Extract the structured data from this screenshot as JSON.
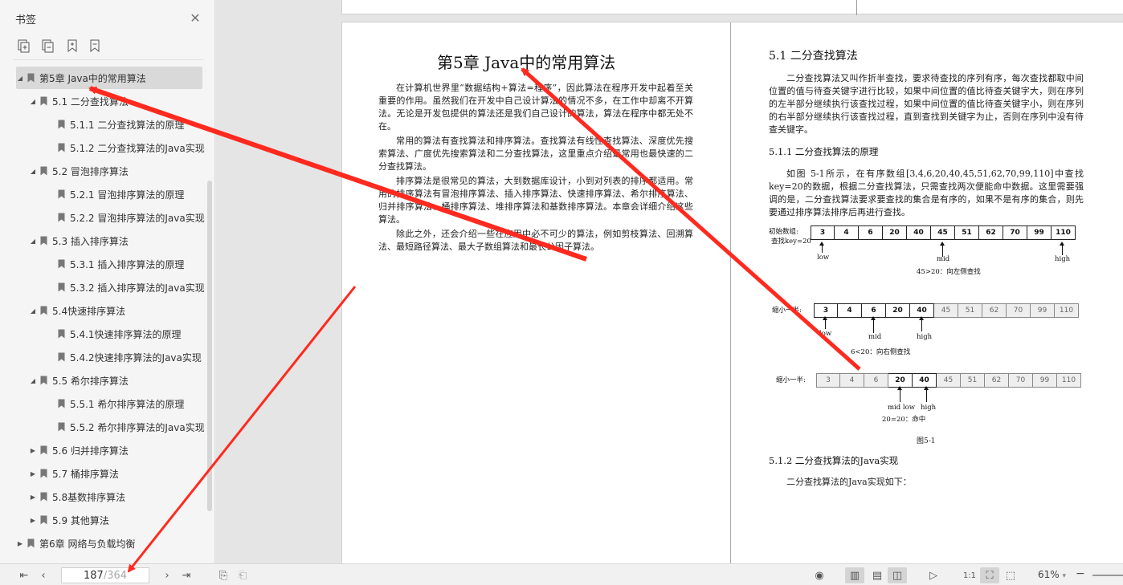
{
  "sidebar": {
    "title": "书签",
    "close_icon": "close-icon",
    "tools": [
      "expand-all-icon",
      "collapse-all-icon",
      "add-bookmark-icon",
      "bookmark-icon"
    ],
    "items": [
      {
        "label": "第5章 Java中的常用算法",
        "level": 0,
        "expanded": true,
        "selected": true
      },
      {
        "label": "5.1 二分查找算法",
        "level": 1,
        "expanded": true
      },
      {
        "label": "5.1.1 二分查找算法的原理",
        "level": 2
      },
      {
        "label": "5.1.2 二分查找算法的Java实现",
        "level": 2
      },
      {
        "label": "5.2 冒泡排序算法",
        "level": 1,
        "expanded": true
      },
      {
        "label": "5.2.1 冒泡排序算法的原理",
        "level": 2
      },
      {
        "label": "5.2.2 冒泡排序算法的Java实现",
        "level": 2
      },
      {
        "label": "5.3 插入排序算法",
        "level": 1,
        "expanded": true
      },
      {
        "label": "5.3.1 插入排序算法的原理",
        "level": 2
      },
      {
        "label": "5.3.2 插入排序算法的Java实现",
        "level": 2
      },
      {
        "label": "5.4快速排序算法",
        "level": 1,
        "expanded": true
      },
      {
        "label": "5.4.1快速排序算法的原理",
        "level": 2
      },
      {
        "label": "5.4.2快速排序算法的Java实现",
        "level": 2
      },
      {
        "label": "5.5 希尔排序算法",
        "level": 1,
        "expanded": true
      },
      {
        "label": "5.5.1 希尔排序算法的原理",
        "level": 2
      },
      {
        "label": "5.5.2 希尔排序算法的Java实现",
        "level": 2
      },
      {
        "label": "5.6 归并排序算法",
        "level": 1,
        "expanded": false
      },
      {
        "label": "5.7 桶排序算法",
        "level": 1,
        "expanded": false
      },
      {
        "label": "5.8基数排序算法",
        "level": 1,
        "expanded": false
      },
      {
        "label": "5.9 其他算法",
        "level": 1,
        "expanded": false
      },
      {
        "label": "第6章 网络与负载均衡",
        "level": 0,
        "expanded": false
      }
    ]
  },
  "document": {
    "left": {
      "chapter_title": "第5章  Java中的常用算法",
      "paragraphs": [
        "在计算机世界里“数据结构+算法=程序”，因此算法在程序开发中起着至关重要的作用。虽然我们在开发中自己设计算法的情况不多，在工作中却离不开算法。无论是开发包提供的算法还是我们自己设计的算法，算法在程序中都无处不在。",
        "常用的算法有查找算法和排序算法。查找算法有线性查找算法、深度优先搜索算法、广度优先搜索算法和二分查找算法，这里重点介绍最常用也最快速的二分查找算法。",
        "排序算法是很常见的算法，大到数据库设计，小到对列表的排序都适用。常用的排序算法有冒泡排序算法、插入排序算法、快速排序算法、希尔排序算法、归并排序算法、桶排序算法、堆排序算法和基数排序算法。本章会详细介绍这些算法。",
        "除此之外，还会介绍一些在应用中必不可少的算法，例如剪枝算法、回溯算法、最短路径算法、最大子数组算法和最长公因子算法。"
      ]
    },
    "right": {
      "section_title": "5.1  二分查找算法",
      "intro": "二分查找算法又叫作折半查找，要求待查找的序列有序，每次查找都取中间位置的值与待查关键字进行比较，如果中间位置的值比待查关键字大，则在序列的左半部分继续执行该查找过程，如果中间位置的值比待查关键字小，则在序列的右半部分继续执行该查找过程，直到查找到关键字为止，否则在序列中没有待查关键字。",
      "sub1_title": "5.1.1  二分查找算法的原理",
      "sub1_text": "如图 5-1所示，在有序数组[3,4,6,20,40,45,51,62,70,99,110]中查找key=20的数据，根据二分查找算法，只需查找两次便能命中数据。这里需要强调的是，二分查找算法要求要查找的集合是有序的，如果不是有序的集合，则先要通过排序算法排序后再进行查找。",
      "figure": {
        "values": [
          "3",
          "4",
          "6",
          "20",
          "40",
          "45",
          "51",
          "62",
          "70",
          "99",
          "110"
        ],
        "row1_label_a": "初始数组:",
        "row1_label_b": "查找key=20",
        "row1_low": "low",
        "row1_mid": "mid",
        "row1_high": "high",
        "row1_note": "45>20：向左侧查找",
        "row2_label": "缩小一半:",
        "row2_low": "low",
        "row2_mid": "mid",
        "row2_high": "high",
        "row2_note": "6<20：向右侧查找",
        "row3_label": "缩小一半:",
        "row3_midlow": "mid low",
        "row3_high": "high",
        "row3_note": "20=20：命中",
        "caption": "图5-1"
      },
      "sub2_title": "5.1.2  二分查找算法的Java实现",
      "sub2_text": "二分查找算法的Java实现如下："
    }
  },
  "statusbar": {
    "current_page": "187",
    "total_pages": "/364",
    "zoom": "61%",
    "zoom_dropdown": "▾"
  },
  "annotation_color": "#ff2a1f"
}
